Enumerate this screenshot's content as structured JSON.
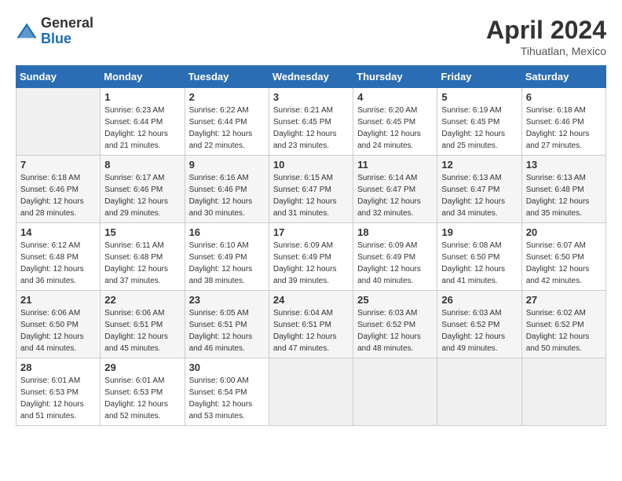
{
  "header": {
    "logo_general": "General",
    "logo_blue": "Blue",
    "month_year": "April 2024",
    "location": "Tihuatlan, Mexico"
  },
  "columns": [
    "Sunday",
    "Monday",
    "Tuesday",
    "Wednesday",
    "Thursday",
    "Friday",
    "Saturday"
  ],
  "weeks": [
    [
      {
        "day": "",
        "sunrise": "",
        "sunset": "",
        "daylight": "",
        "empty": true
      },
      {
        "day": "1",
        "sunrise": "Sunrise: 6:23 AM",
        "sunset": "Sunset: 6:44 PM",
        "daylight": "Daylight: 12 hours and 21 minutes."
      },
      {
        "day": "2",
        "sunrise": "Sunrise: 6:22 AM",
        "sunset": "Sunset: 6:44 PM",
        "daylight": "Daylight: 12 hours and 22 minutes."
      },
      {
        "day": "3",
        "sunrise": "Sunrise: 6:21 AM",
        "sunset": "Sunset: 6:45 PM",
        "daylight": "Daylight: 12 hours and 23 minutes."
      },
      {
        "day": "4",
        "sunrise": "Sunrise: 6:20 AM",
        "sunset": "Sunset: 6:45 PM",
        "daylight": "Daylight: 12 hours and 24 minutes."
      },
      {
        "day": "5",
        "sunrise": "Sunrise: 6:19 AM",
        "sunset": "Sunset: 6:45 PM",
        "daylight": "Daylight: 12 hours and 25 minutes."
      },
      {
        "day": "6",
        "sunrise": "Sunrise: 6:18 AM",
        "sunset": "Sunset: 6:46 PM",
        "daylight": "Daylight: 12 hours and 27 minutes."
      }
    ],
    [
      {
        "day": "7",
        "sunrise": "Sunrise: 6:18 AM",
        "sunset": "Sunset: 6:46 PM",
        "daylight": "Daylight: 12 hours and 28 minutes."
      },
      {
        "day": "8",
        "sunrise": "Sunrise: 6:17 AM",
        "sunset": "Sunset: 6:46 PM",
        "daylight": "Daylight: 12 hours and 29 minutes."
      },
      {
        "day": "9",
        "sunrise": "Sunrise: 6:16 AM",
        "sunset": "Sunset: 6:46 PM",
        "daylight": "Daylight: 12 hours and 30 minutes."
      },
      {
        "day": "10",
        "sunrise": "Sunrise: 6:15 AM",
        "sunset": "Sunset: 6:47 PM",
        "daylight": "Daylight: 12 hours and 31 minutes."
      },
      {
        "day": "11",
        "sunrise": "Sunrise: 6:14 AM",
        "sunset": "Sunset: 6:47 PM",
        "daylight": "Daylight: 12 hours and 32 minutes."
      },
      {
        "day": "12",
        "sunrise": "Sunrise: 6:13 AM",
        "sunset": "Sunset: 6:47 PM",
        "daylight": "Daylight: 12 hours and 34 minutes."
      },
      {
        "day": "13",
        "sunrise": "Sunrise: 6:13 AM",
        "sunset": "Sunset: 6:48 PM",
        "daylight": "Daylight: 12 hours and 35 minutes."
      }
    ],
    [
      {
        "day": "14",
        "sunrise": "Sunrise: 6:12 AM",
        "sunset": "Sunset: 6:48 PM",
        "daylight": "Daylight: 12 hours and 36 minutes."
      },
      {
        "day": "15",
        "sunrise": "Sunrise: 6:11 AM",
        "sunset": "Sunset: 6:48 PM",
        "daylight": "Daylight: 12 hours and 37 minutes."
      },
      {
        "day": "16",
        "sunrise": "Sunrise: 6:10 AM",
        "sunset": "Sunset: 6:49 PM",
        "daylight": "Daylight: 12 hours and 38 minutes."
      },
      {
        "day": "17",
        "sunrise": "Sunrise: 6:09 AM",
        "sunset": "Sunset: 6:49 PM",
        "daylight": "Daylight: 12 hours and 39 minutes."
      },
      {
        "day": "18",
        "sunrise": "Sunrise: 6:09 AM",
        "sunset": "Sunset: 6:49 PM",
        "daylight": "Daylight: 12 hours and 40 minutes."
      },
      {
        "day": "19",
        "sunrise": "Sunrise: 6:08 AM",
        "sunset": "Sunset: 6:50 PM",
        "daylight": "Daylight: 12 hours and 41 minutes."
      },
      {
        "day": "20",
        "sunrise": "Sunrise: 6:07 AM",
        "sunset": "Sunset: 6:50 PM",
        "daylight": "Daylight: 12 hours and 42 minutes."
      }
    ],
    [
      {
        "day": "21",
        "sunrise": "Sunrise: 6:06 AM",
        "sunset": "Sunset: 6:50 PM",
        "daylight": "Daylight: 12 hours and 44 minutes."
      },
      {
        "day": "22",
        "sunrise": "Sunrise: 6:06 AM",
        "sunset": "Sunset: 6:51 PM",
        "daylight": "Daylight: 12 hours and 45 minutes."
      },
      {
        "day": "23",
        "sunrise": "Sunrise: 6:05 AM",
        "sunset": "Sunset: 6:51 PM",
        "daylight": "Daylight: 12 hours and 46 minutes."
      },
      {
        "day": "24",
        "sunrise": "Sunrise: 6:04 AM",
        "sunset": "Sunset: 6:51 PM",
        "daylight": "Daylight: 12 hours and 47 minutes."
      },
      {
        "day": "25",
        "sunrise": "Sunrise: 6:03 AM",
        "sunset": "Sunset: 6:52 PM",
        "daylight": "Daylight: 12 hours and 48 minutes."
      },
      {
        "day": "26",
        "sunrise": "Sunrise: 6:03 AM",
        "sunset": "Sunset: 6:52 PM",
        "daylight": "Daylight: 12 hours and 49 minutes."
      },
      {
        "day": "27",
        "sunrise": "Sunrise: 6:02 AM",
        "sunset": "Sunset: 6:52 PM",
        "daylight": "Daylight: 12 hours and 50 minutes."
      }
    ],
    [
      {
        "day": "28",
        "sunrise": "Sunrise: 6:01 AM",
        "sunset": "Sunset: 6:53 PM",
        "daylight": "Daylight: 12 hours and 51 minutes."
      },
      {
        "day": "29",
        "sunrise": "Sunrise: 6:01 AM",
        "sunset": "Sunset: 6:53 PM",
        "daylight": "Daylight: 12 hours and 52 minutes."
      },
      {
        "day": "30",
        "sunrise": "Sunrise: 6:00 AM",
        "sunset": "Sunset: 6:54 PM",
        "daylight": "Daylight: 12 hours and 53 minutes."
      },
      {
        "day": "",
        "sunrise": "",
        "sunset": "",
        "daylight": "",
        "empty": true
      },
      {
        "day": "",
        "sunrise": "",
        "sunset": "",
        "daylight": "",
        "empty": true
      },
      {
        "day": "",
        "sunrise": "",
        "sunset": "",
        "daylight": "",
        "empty": true
      },
      {
        "day": "",
        "sunrise": "",
        "sunset": "",
        "daylight": "",
        "empty": true
      }
    ]
  ]
}
